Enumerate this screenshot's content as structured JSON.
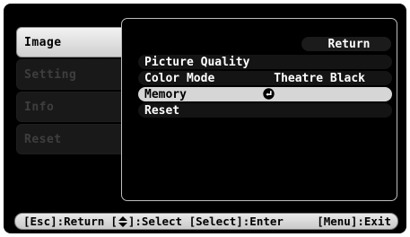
{
  "menu": {
    "items": [
      {
        "label": "Image",
        "active": true
      },
      {
        "label": "Setting",
        "active": false
      },
      {
        "label": "Info",
        "active": false
      },
      {
        "label": "Reset",
        "active": false
      }
    ]
  },
  "panel": {
    "return_label": "Return",
    "rows": [
      {
        "label": "Picture Quality",
        "value": ""
      },
      {
        "label": "Color Mode",
        "value": "Theatre Black"
      },
      {
        "label": "Memory",
        "value": "",
        "selected": true
      },
      {
        "label": "Reset",
        "value": ""
      }
    ]
  },
  "help": {
    "esc": "[Esc]:Return",
    "select": "]:Select [Select]:Enter",
    "select_prefix": "[",
    "exit": "[Menu]:Exit"
  },
  "colors": {
    "background": "#000000",
    "highlight": "#d6d6d6",
    "text": "#ffffff"
  },
  "icons": {
    "memory_row": "enter-icon",
    "help_updown": "up-down-arrow-icon"
  }
}
